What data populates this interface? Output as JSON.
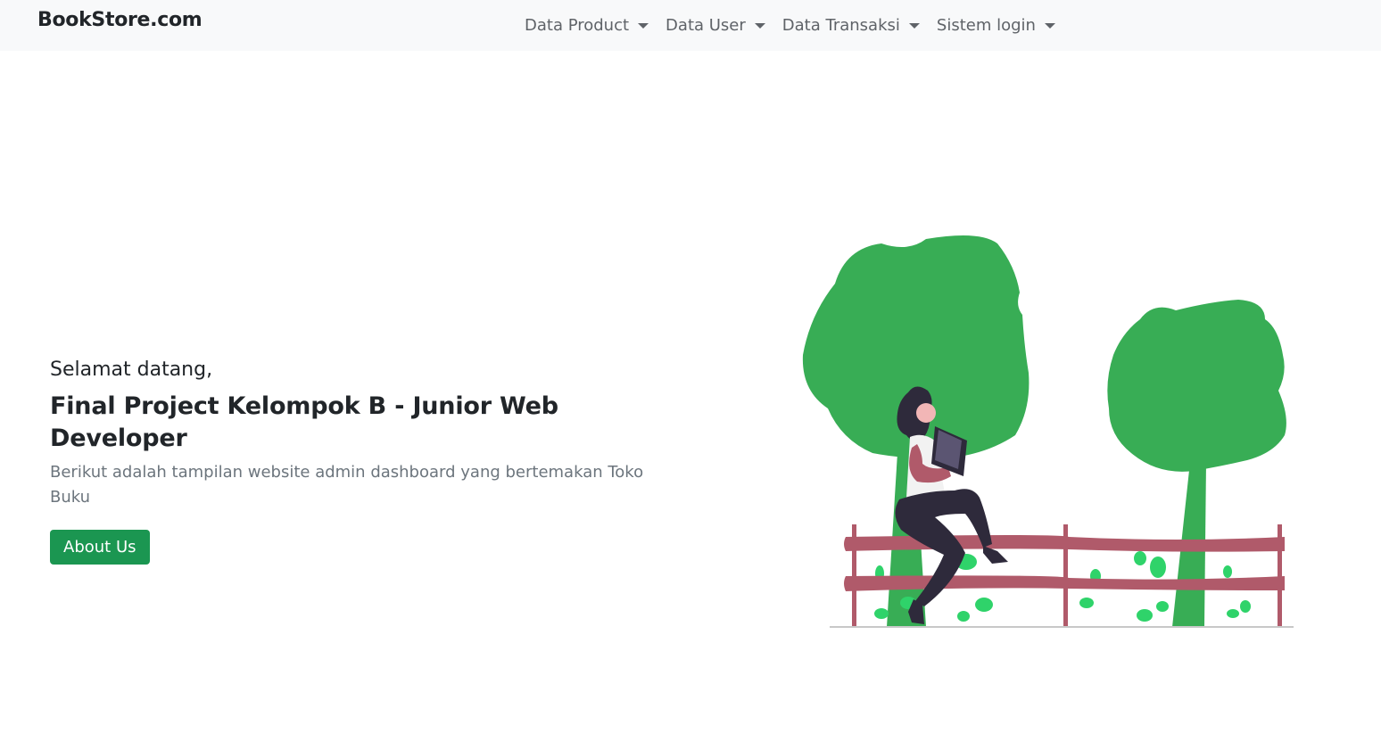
{
  "navbar": {
    "brand": "BookStore.com",
    "items": [
      {
        "label": "Data Product"
      },
      {
        "label": "Data User"
      },
      {
        "label": "Data Transaksi"
      },
      {
        "label": "Sistem login"
      }
    ]
  },
  "hero": {
    "greeting": "Selamat datang,",
    "title": "Final Project Kelompok B - Junior Web Developer",
    "description": "Berikut adalah tampilan website admin dashboard yang bertemakan Toko Buku",
    "button_label": "About Us"
  },
  "colors": {
    "navbar_bg": "#f8f9fa",
    "button_green": "#1b9651",
    "tree_green": "#38ad55",
    "fence": "#b05a6a",
    "plant_green": "#2fd36a"
  },
  "illustration": "woman-reading-book-on-fence-illustration"
}
